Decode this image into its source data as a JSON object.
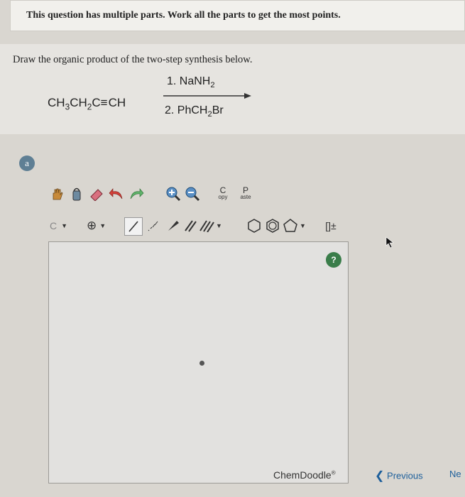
{
  "header": {
    "instruction": "This question has multiple parts. Work all the parts to get the most points."
  },
  "question": {
    "prompt": "Draw the organic product of the two-step synthesis below.",
    "reactant": {
      "part1": "CH",
      "sub1": "3",
      "part2": "CH",
      "sub2": "2",
      "part3": "C",
      "bond": "≡",
      "part4": "CH"
    },
    "reagent1": {
      "text": "1. NaNH",
      "sub": "2"
    },
    "reagent2": {
      "text": "2. PhCH",
      "sub": "2",
      "tail": "Br"
    }
  },
  "part": {
    "label": "a"
  },
  "toolbar": {
    "copy_big": "C",
    "copy_small": "opy",
    "paste_big": "P",
    "paste_small": "aste",
    "element_label": "C",
    "bracket_label": "[]±"
  },
  "canvas": {
    "help": "?",
    "brand": "ChemDoodle",
    "brand_mark": "®"
  },
  "nav": {
    "previous": "Previous",
    "next": "Ne"
  }
}
